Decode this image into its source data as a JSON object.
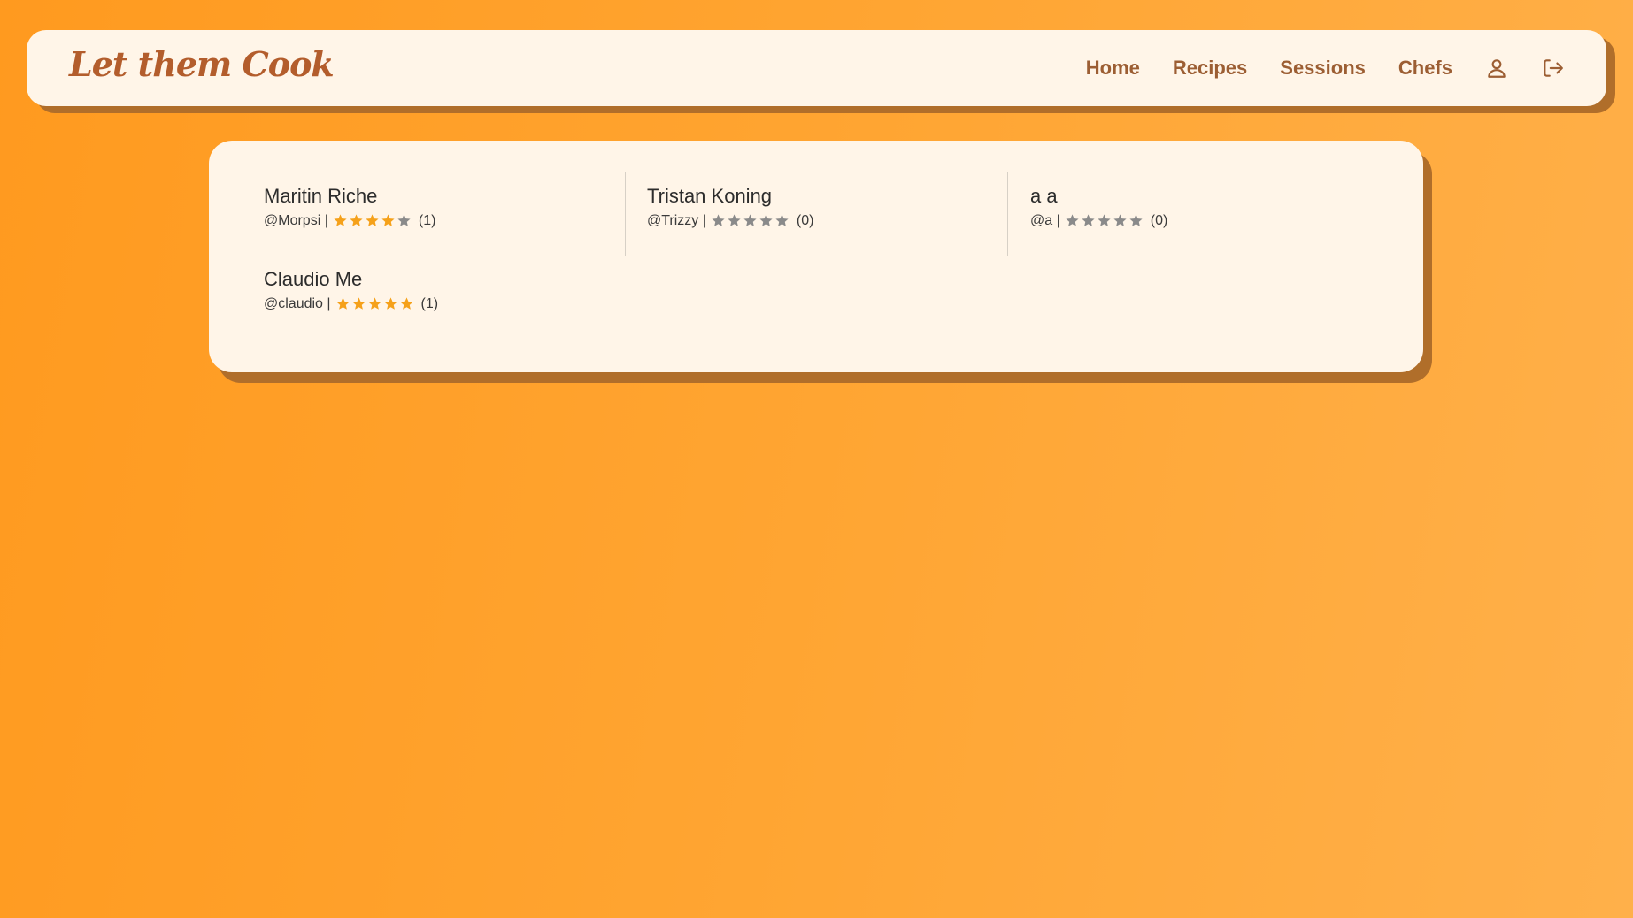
{
  "app": {
    "logo_text": "Let them Cook"
  },
  "nav": {
    "links": [
      {
        "label": "Home"
      },
      {
        "label": "Recipes"
      },
      {
        "label": "Sessions"
      },
      {
        "label": "Chefs"
      }
    ],
    "icons": {
      "profile": "user-icon",
      "logout": "logout-icon"
    }
  },
  "colors": {
    "accent": "#ff9a1f",
    "nav_text": "#9c5e33",
    "logo": "#b35d2c",
    "star_filled": "#f5a11a",
    "star_empty": "#8a8a8a",
    "card_bg": "#fff5e8"
  },
  "chefs": [
    {
      "name": "Maritin Riche",
      "handle": "@Morpsi |",
      "rating": 4,
      "count": "(1)"
    },
    {
      "name": "Tristan Koning",
      "handle": "@Trizzy |",
      "rating": 0,
      "count": "(0)"
    },
    {
      "name": "a a",
      "handle": "@a |",
      "rating": 0,
      "count": "(0)"
    },
    {
      "name": "Claudio Me",
      "handle": "@claudio |",
      "rating": 5,
      "count": "(1)"
    }
  ]
}
